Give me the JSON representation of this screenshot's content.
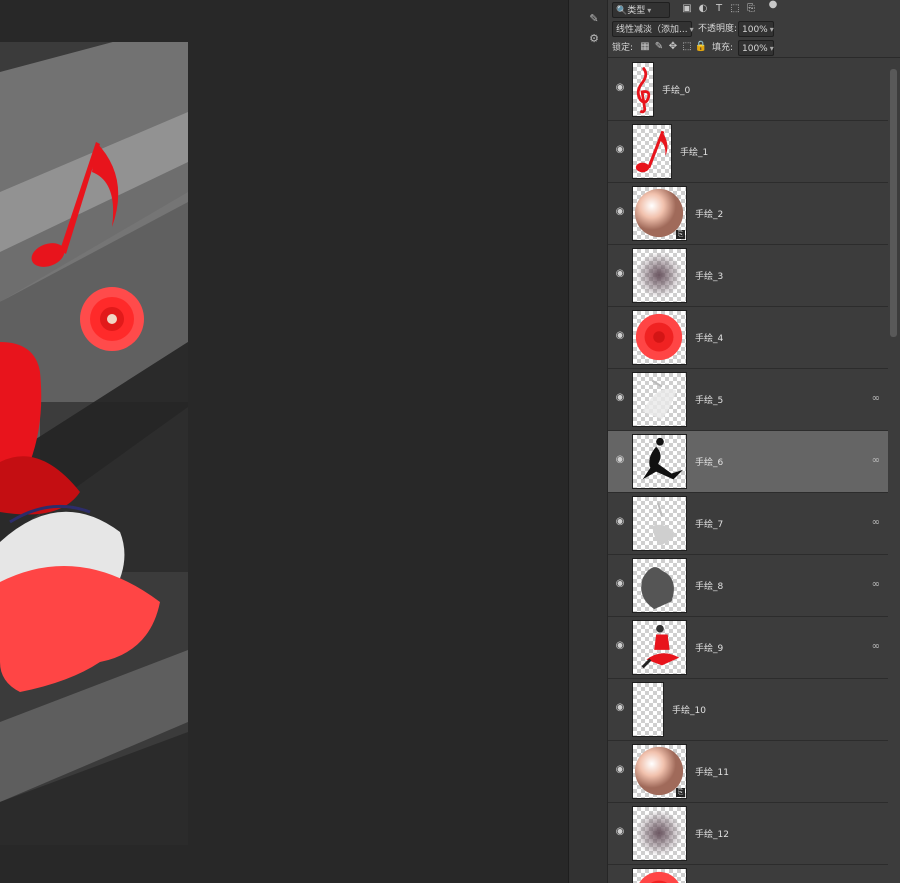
{
  "toolbar": {
    "filter_kind": "类型",
    "blend_mode": "线性减淡（添加...",
    "opacity_label": "不透明度:",
    "opacity_value": "100%",
    "lock_label": "锁定:",
    "fill_label": "填充:",
    "fill_value": "100%"
  },
  "icons": {
    "filter": "search-icon",
    "image_filter": "image-icon",
    "adjust_filter": "half-circle-icon",
    "type_filter": "text-icon",
    "shape_filter": "shape-icon",
    "smart_filter": "smart-object-icon",
    "toggle": "dot-icon"
  },
  "layers": [
    {
      "name": "手绘_0",
      "thumb": "treble-clef",
      "linked": false,
      "smart": false,
      "selected": false
    },
    {
      "name": "手绘_1",
      "thumb": "note",
      "linked": false,
      "smart": false,
      "selected": false
    },
    {
      "name": "手绘_2",
      "thumb": "pearl",
      "linked": false,
      "smart": true,
      "selected": false
    },
    {
      "name": "手绘_3",
      "thumb": "shadow-blob",
      "linked": false,
      "smart": false,
      "selected": false
    },
    {
      "name": "手绘_4",
      "thumb": "red-flower",
      "linked": false,
      "smart": false,
      "selected": false
    },
    {
      "name": "手绘_5",
      "thumb": "white-dancer",
      "linked": true,
      "smart": false,
      "selected": false
    },
    {
      "name": "手绘_6",
      "thumb": "black-dancer",
      "linked": true,
      "smart": false,
      "selected": true
    },
    {
      "name": "手绘_7",
      "thumb": "grey-dancer",
      "linked": true,
      "smart": false,
      "selected": false
    },
    {
      "name": "手绘_8",
      "thumb": "dark-shadow",
      "linked": true,
      "smart": false,
      "selected": false
    },
    {
      "name": "手绘_9",
      "thumb": "red-dancer",
      "linked": true,
      "smart": false,
      "selected": false
    },
    {
      "name": "手绘_10",
      "thumb": "empty",
      "linked": false,
      "smart": false,
      "selected": false
    },
    {
      "name": "手绘_11",
      "thumb": "pearl",
      "linked": false,
      "smart": true,
      "selected": false
    },
    {
      "name": "手绘_12",
      "thumb": "shadow-blob",
      "linked": false,
      "smart": false,
      "selected": false
    },
    {
      "name": "",
      "thumb": "red-flower",
      "linked": false,
      "smart": false,
      "selected": false
    }
  ],
  "colors": {
    "accent_red": "#e8141c",
    "selected_row": "#656565",
    "panel_bg": "#3c3c3c"
  }
}
